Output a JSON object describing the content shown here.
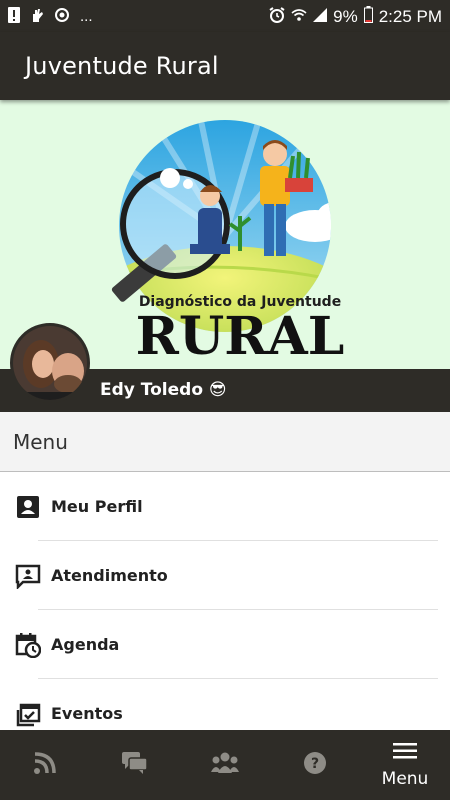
{
  "status_bar": {
    "left_icons": [
      "alert-icon",
      "hand-icon",
      "sync-icon",
      "more-icon"
    ],
    "more_text": "...",
    "battery": "9%",
    "time": "2:25 PM"
  },
  "app_bar": {
    "title": "Juventude Rural"
  },
  "banner": {
    "logo_text_top": "Diagnóstico da Juventude",
    "logo_text_big": "RURAL"
  },
  "profile": {
    "name": "Edy Toledo 😎"
  },
  "menu": {
    "header": "Menu",
    "items": [
      {
        "label": "Meu Perfil",
        "icon": "profile-icon"
      },
      {
        "label": "Atendimento",
        "icon": "chat-person-icon"
      },
      {
        "label": "Agenda",
        "icon": "calendar-clock-icon"
      },
      {
        "label": "Eventos",
        "icon": "events-icon"
      }
    ]
  },
  "bottom_nav": {
    "items": [
      {
        "icon": "rss-icon"
      },
      {
        "icon": "chat-icon"
      },
      {
        "icon": "group-icon"
      },
      {
        "icon": "help-icon"
      },
      {
        "icon": "menu-icon",
        "label": "Menu",
        "active": true
      }
    ]
  },
  "colors": {
    "dark": "#2e2c27",
    "banner_bg": "#e3fbe3",
    "inactive_nav": "#8e8c86"
  }
}
